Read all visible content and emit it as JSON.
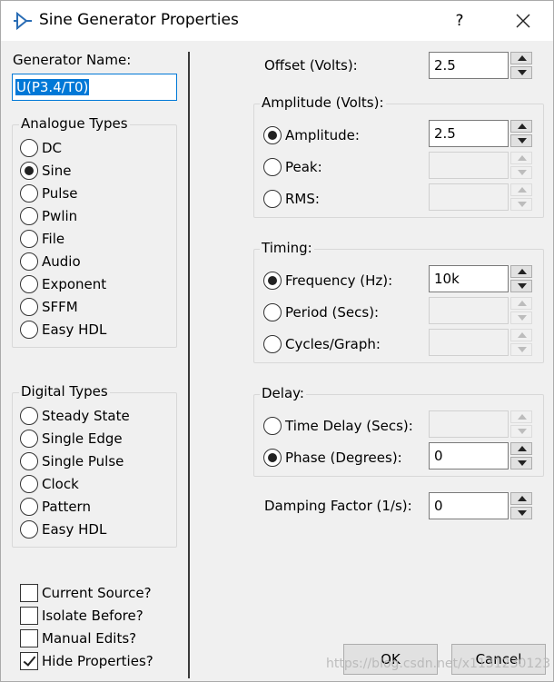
{
  "window": {
    "title": "Sine Generator Properties",
    "help_label": "?",
    "icon": "sine-generator-icon"
  },
  "generator_name": {
    "label": "Generator Name:",
    "value": "U(P3.4/T0)"
  },
  "analogue_types": {
    "title": "Analogue Types",
    "items": [
      {
        "label": "DC",
        "selected": false
      },
      {
        "label": "Sine",
        "selected": true
      },
      {
        "label": "Pulse",
        "selected": false
      },
      {
        "label": "Pwlin",
        "selected": false
      },
      {
        "label": "File",
        "selected": false
      },
      {
        "label": "Audio",
        "selected": false
      },
      {
        "label": "Exponent",
        "selected": false
      },
      {
        "label": "SFFM",
        "selected": false
      },
      {
        "label": "Easy HDL",
        "selected": false
      }
    ]
  },
  "digital_types": {
    "title": "Digital Types",
    "items": [
      {
        "label": "Steady State",
        "selected": false
      },
      {
        "label": "Single Edge",
        "selected": false
      },
      {
        "label": "Single Pulse",
        "selected": false
      },
      {
        "label": "Clock",
        "selected": false
      },
      {
        "label": "Pattern",
        "selected": false
      },
      {
        "label": "Easy HDL",
        "selected": false
      }
    ]
  },
  "options": [
    {
      "label": "Current Source?",
      "checked": false
    },
    {
      "label": "Isolate Before?",
      "checked": false
    },
    {
      "label": "Manual Edits?",
      "checked": false
    },
    {
      "label": "Hide Properties?",
      "checked": true
    }
  ],
  "offset": {
    "label": "Offset (Volts):",
    "value": "2.5"
  },
  "amplitude": {
    "title": "Amplitude (Volts):",
    "rows": [
      {
        "label": "Amplitude:",
        "selected": true,
        "value": "2.5",
        "enabled": true
      },
      {
        "label": "Peak:",
        "selected": false,
        "value": "",
        "enabled": false
      },
      {
        "label": "RMS:",
        "selected": false,
        "value": "",
        "enabled": false
      }
    ]
  },
  "timing": {
    "title": "Timing:",
    "rows": [
      {
        "label": "Frequency (Hz):",
        "selected": true,
        "value": "10k",
        "enabled": true
      },
      {
        "label": "Period (Secs):",
        "selected": false,
        "value": "",
        "enabled": false
      },
      {
        "label": "Cycles/Graph:",
        "selected": false,
        "value": "",
        "enabled": false
      }
    ]
  },
  "delay": {
    "title": "Delay:",
    "rows": [
      {
        "label": "Time Delay (Secs):",
        "selected": false,
        "value": "",
        "enabled": false
      },
      {
        "label": "Phase (Degrees):",
        "selected": true,
        "value": "0",
        "enabled": true
      }
    ]
  },
  "damping": {
    "label": "Damping Factor (1/s):",
    "value": "0"
  },
  "buttons": {
    "ok": "OK",
    "cancel": "Cancel"
  },
  "watermark": "https://blog.csdn.net/x1131230123"
}
